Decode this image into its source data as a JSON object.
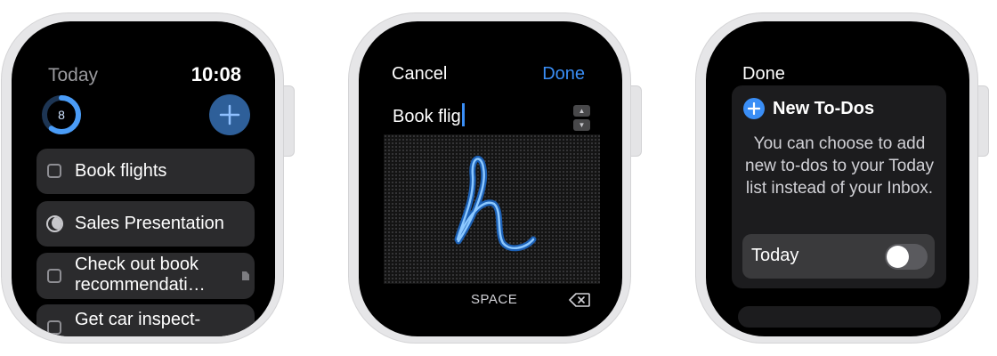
{
  "watch1": {
    "header_title": "Today",
    "time": "10:08",
    "progress_count": "8",
    "progress_fraction": 0.6,
    "tasks": [
      {
        "label": "Book flights"
      },
      {
        "label": "Sales Presentation"
      },
      {
        "label_line1": "Check out book",
        "label_line2": "recommendati…"
      },
      {
        "label": "Get car inspect-"
      }
    ]
  },
  "watch2": {
    "cancel_label": "Cancel",
    "done_label": "Done",
    "input_text": "Book flig",
    "space_label": "SPACE"
  },
  "watch3": {
    "done_label": "Done",
    "card_title": "New To-Dos",
    "card_body": "You can choose to add new to-dos to your Today list instead of your Inbox.",
    "toggle_label": "Today",
    "toggle_on": false
  },
  "colors": {
    "accent_blue": "#3a8ef6",
    "ring_blue": "#4a9cf7",
    "plus_button_bg": "#2e5f99"
  }
}
